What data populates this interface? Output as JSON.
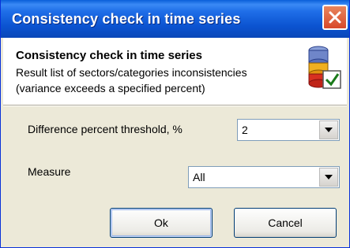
{
  "window": {
    "title": "Consistency check in time series"
  },
  "header": {
    "title": "Consistency check in time series",
    "description_line1": "Result list of sectors/categories inconsistencies",
    "description_line2": "(variance exceeds a specified percent)",
    "icon": "database-check-icon"
  },
  "form": {
    "threshold_label": "Difference percent threshold, %",
    "threshold_value": "2",
    "measure_label": "Measure",
    "measure_value": "All"
  },
  "buttons": {
    "ok_label": "Ok",
    "cancel_label": "Cancel"
  }
}
